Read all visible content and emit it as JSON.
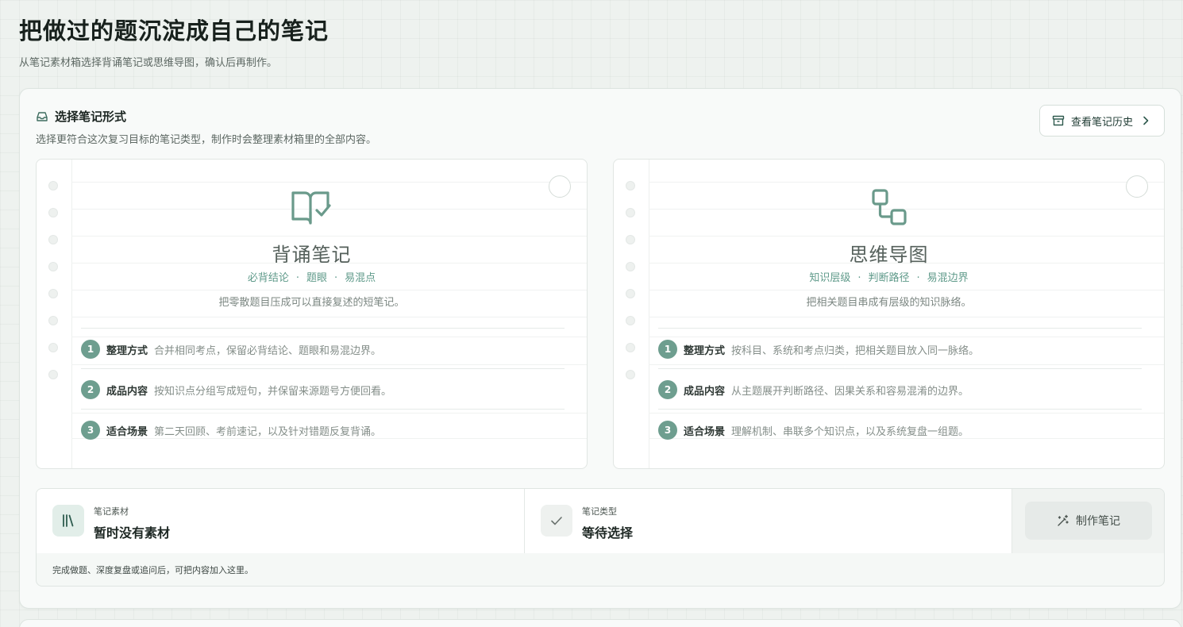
{
  "page": {
    "title": "把做过的题沉淀成自己的笔记",
    "subtitle": "从笔记素材箱选择背诵笔记或思维导图，确认后再制作。"
  },
  "panel": {
    "icon": "inbox-icon",
    "title": "选择笔记形式",
    "description": "选择更符合这次复习目标的笔记类型，制作时会整理素材箱里的全部内容。",
    "history_button": {
      "label": "查看笔记历史",
      "icon": "archive-icon",
      "chevron": "chevron-right-icon"
    }
  },
  "cards": [
    {
      "icon": "book-check-icon",
      "title": "背诵笔记",
      "tags": [
        "必背结论",
        "题眼",
        "易混点"
      ],
      "description": "把零散题目压成可以直接复述的短笔记。",
      "rows": [
        {
          "num": "1",
          "label": "整理方式",
          "text": "合并相同考点，保留必背结论、题眼和易混边界。"
        },
        {
          "num": "2",
          "label": "成品内容",
          "text": "按知识点分组写成短句，并保留来源题号方便回看。"
        },
        {
          "num": "3",
          "label": "适合场景",
          "text": "第二天回顾、考前速记，以及针对错题反复背诵。"
        }
      ]
    },
    {
      "icon": "mindmap-icon",
      "title": "思维导图",
      "tags": [
        "知识层级",
        "判断路径",
        "易混边界"
      ],
      "description": "把相关题目串成有层级的知识脉络。",
      "rows": [
        {
          "num": "1",
          "label": "整理方式",
          "text": "按科目、系统和考点归类，把相关题目放入同一脉络。"
        },
        {
          "num": "2",
          "label": "成品内容",
          "text": "从主题展开判断路径、因果关系和容易混淆的边界。"
        },
        {
          "num": "3",
          "label": "适合场景",
          "text": "理解机制、串联多个知识点，以及系统复盘一组题。"
        }
      ]
    }
  ],
  "summary": {
    "material": {
      "icon": "library-icon",
      "label": "笔记素材",
      "value": "暂时没有素材"
    },
    "type": {
      "icon": "check-icon",
      "label": "笔记类型",
      "value": "等待选择"
    },
    "make_button": {
      "label": "制作笔记",
      "icon": "magic-wand-icon"
    },
    "footer": "完成做题、深度复盘或追问后，可把内容加入这里。"
  },
  "colors": {
    "accent": "#5f9a8a",
    "badge": "#6e9e8f",
    "icon_stroke": "#6a9a8b"
  }
}
